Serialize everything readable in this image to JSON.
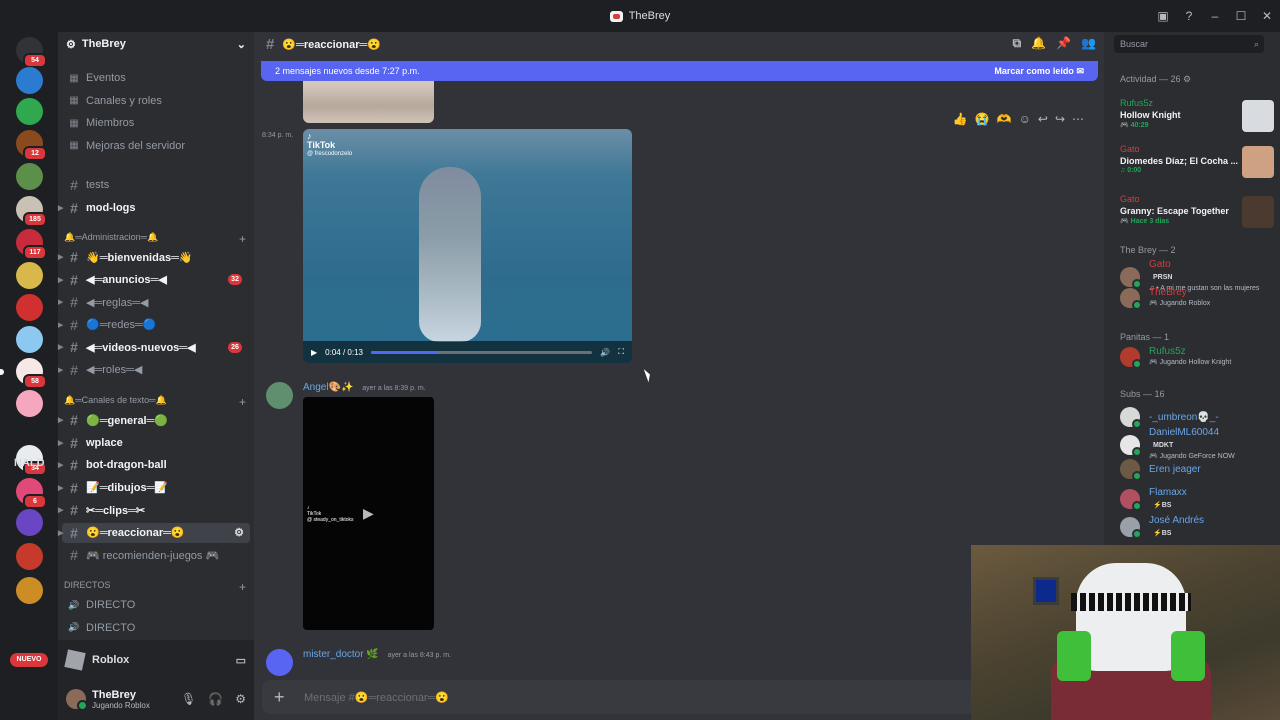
{
  "window": {
    "title": "TheBrey"
  },
  "guilds": {
    "home_badge": "54",
    "items": [
      {
        "color": "#2b7bd1",
        "badge": ""
      },
      {
        "color": "#2fa84f",
        "badge": ""
      },
      {
        "color": "#8b4a1d",
        "badge": "12"
      },
      {
        "color": "#5c8f4a",
        "badge": ""
      },
      {
        "color": "#c9c1b4",
        "badge": "185"
      },
      {
        "color": "#c82c3c",
        "badge": "117"
      },
      {
        "color": "#d8b84a",
        "badge": ""
      },
      {
        "color": "#d13030",
        "badge": ""
      },
      {
        "color": "#8dc8f0",
        "badge": ""
      },
      {
        "color": "#f7e8e8",
        "badge": "58"
      },
      {
        "color": "#f6a7c0",
        "badge": ""
      },
      {
        "color": "#e9ecef",
        "badge": "34"
      },
      {
        "color": "#e04a79",
        "badge": "6"
      },
      {
        "color": "#6a45c4",
        "badge": ""
      },
      {
        "color": "#c53a2a",
        "badge": ""
      },
      {
        "color": "#cc8d25",
        "badge": ""
      }
    ],
    "folder_label": "NALD",
    "new_label": "NUEVO"
  },
  "server": {
    "name": "TheBrey",
    "menu": [
      {
        "icon": "calendar-icon",
        "label": "Eventos"
      },
      {
        "icon": "list-icon",
        "label": "Canales y roles"
      },
      {
        "icon": "members-icon",
        "label": "Miembros"
      },
      {
        "icon": "boost-icon",
        "label": "Mejoras del servidor"
      }
    ],
    "channels_top": [
      {
        "label": "tests",
        "unread": false
      },
      {
        "label": "mod-logs",
        "unread": true
      }
    ],
    "cat_admin": "🔔═Administracion═🔔",
    "channels_admin": [
      {
        "label": "👋═bienvenidas═👋",
        "unread": true,
        "count": ""
      },
      {
        "label": "◀═anuncios═◀",
        "unread": true,
        "count": "32"
      },
      {
        "label": "◀═reglas═◀",
        "unread": false,
        "count": ""
      },
      {
        "label": "🔵═redes═🔵",
        "unread": false,
        "count": ""
      },
      {
        "label": "◀═videos-nuevos═◀",
        "unread": true,
        "count": "26"
      },
      {
        "label": "◀═roles═◀",
        "unread": false,
        "count": ""
      }
    ],
    "cat_text": "🔔═Canales de texto═🔔",
    "channels_text": [
      {
        "label": "🟢═general═🟢",
        "unread": true
      },
      {
        "label": "wplace",
        "unread": true
      },
      {
        "label": "bot-dragon-ball",
        "unread": true
      },
      {
        "label": "📝═dibujos═📝",
        "unread": true
      },
      {
        "label": "✂═clips═✂",
        "unread": true
      },
      {
        "label": "😮═reaccionar═😮",
        "unread": true,
        "active": true
      },
      {
        "label": "🎮 recomienden-juegos 🎮",
        "unread": false
      }
    ],
    "cat_direct": "DIRECTOS",
    "voice": [
      {
        "label": "DIRECTO"
      },
      {
        "label": "DIRECTO"
      }
    ]
  },
  "userpanel": {
    "activity": "Roblox",
    "name": "TheBrey",
    "status": "Jugando Roblox"
  },
  "channel": {
    "name": "😮═reaccionar═😮",
    "new_messages": "2 mensajes nuevos desde 7:27 p.m.",
    "mark_read": "Marcar como leído",
    "time1": "8:34 p. m.",
    "video": {
      "time": "0:04 / 0:13",
      "progress": 0.3,
      "brand": "TikTok",
      "handle": "@ frescodonzelo"
    },
    "msg2": {
      "author": "Angel🎨✨",
      "time": "ayer a las 8:39 p. m.",
      "brand": "TikTok",
      "handle": "@ steady_on_tiktoks"
    },
    "msg3": {
      "author": "mister_doctor 🌿",
      "time": "ayer a las 8:43 p. m."
    },
    "placeholder": "Mensaje #😮═reaccionar═😮"
  },
  "members": {
    "search": "Buscar",
    "activity_header": "Actividad — 26",
    "activities": [
      {
        "name": "Rufus5z",
        "name_color": "#23a55a",
        "game": "Hollow Knight",
        "time": "🎮 40:29",
        "thumb": "#d8dbe0"
      },
      {
        "name": "Gato",
        "name_color": "#d13f3f",
        "game": "Diomedes Díaz; El Cocha ...",
        "time": "♫ 0:00",
        "thumb": "#cfa183"
      },
      {
        "name": "Gato",
        "name_color": "#d13f3f",
        "game": "Granny: Escape Together",
        "time": "🎮 Hace 3 días",
        "thumb": "#4a3a30"
      }
    ],
    "groups": [
      {
        "title": "The Brey — 2",
        "items": [
          {
            "name": "Gato",
            "color": "#d13f3f",
            "tag": "PRSN",
            "sub": "♫ • A mi me gustan son las mujeres",
            "av": "#8a6b5a"
          },
          {
            "name": "TheBrey",
            "color": "#d13f3f",
            "tag": "",
            "sub": "🎮 Jugando Roblox",
            "av": "#8a6b5a"
          }
        ]
      },
      {
        "title": "Panitas — 1",
        "items": [
          {
            "name": "Rufus5z",
            "color": "#23a55a",
            "tag": "",
            "sub": "🎮 Jugando Hollow Knight",
            "av": "#b23b2e"
          }
        ]
      },
      {
        "title": "Subs — 16",
        "items": [
          {
            "name": "-_umbreon💀_-",
            "color": "#6aa6e8",
            "tag": "",
            "sub": "",
            "av": "#d8d8d8"
          },
          {
            "name": "DanielML60044",
            "color": "#6aa6e8",
            "tag": "MDKT",
            "sub": "🎮 Jugando GeForce NOW",
            "av": "#e6e6e6"
          },
          {
            "name": "Eren jeager",
            "color": "#6aa6e8",
            "tag": "",
            "sub": "",
            "av": "#6c5a45"
          },
          {
            "name": "Flamaxx",
            "color": "#6aa6e8",
            "tag": "⚡BS",
            "sub": "",
            "av": "#b05060"
          },
          {
            "name": "José Andrés",
            "color": "#6aa6e8",
            "tag": "⚡BS",
            "sub": "",
            "av": "#9aa0a8"
          }
        ]
      }
    ]
  }
}
